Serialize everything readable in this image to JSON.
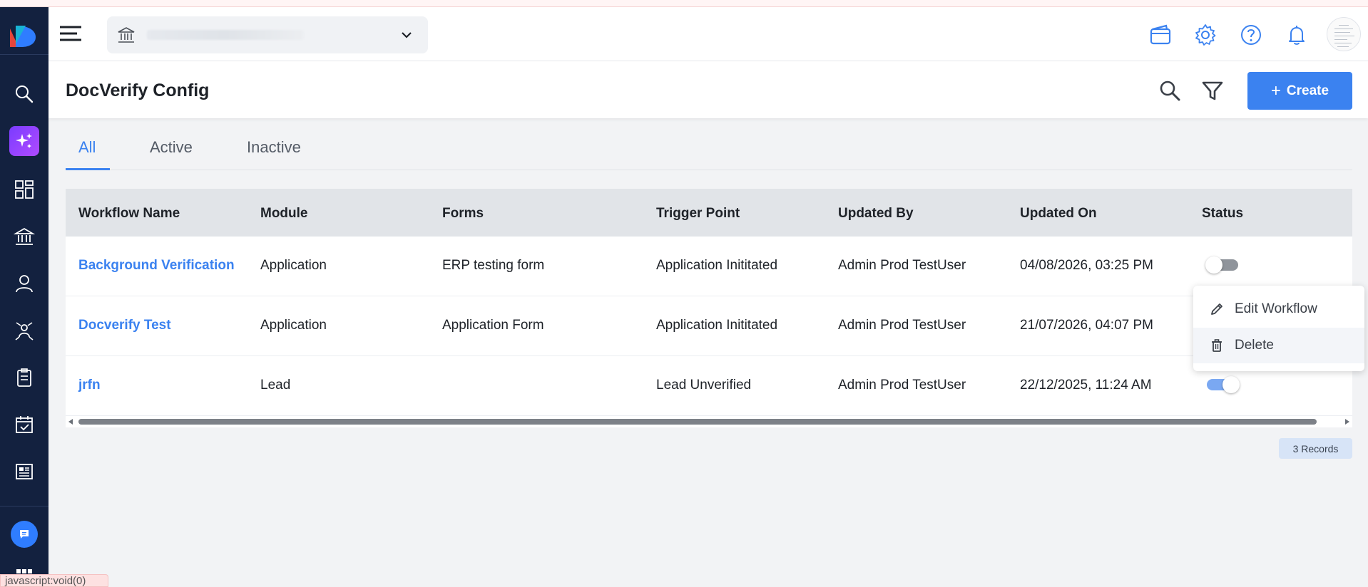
{
  "page": {
    "title": "DocVerify Config",
    "create_label": "Create"
  },
  "tabs": [
    {
      "label": "All",
      "active": true
    },
    {
      "label": "Active",
      "active": false
    },
    {
      "label": "Inactive",
      "active": false
    }
  ],
  "table": {
    "columns": [
      "Workflow Name",
      "Module",
      "Forms",
      "Trigger Point",
      "Updated By",
      "Updated On",
      "Status"
    ],
    "rows": [
      {
        "name": "Background Verification",
        "module": "Application",
        "forms": "ERP testing form",
        "trigger": "Application Inititated",
        "updated_by": "Admin Prod TestUser",
        "updated_on": "04/08/2026, 03:25 PM",
        "status_on": false
      },
      {
        "name": "Docverify Test",
        "module": "Application",
        "forms": "Application Form",
        "trigger": "Application Inititated",
        "updated_by": "Admin Prod TestUser",
        "updated_on": "21/07/2026, 04:07 PM",
        "status_on": null
      },
      {
        "name": "jrfn",
        "module": "Lead",
        "forms": "",
        "trigger": "Lead Unverified",
        "updated_by": "Admin Prod TestUser",
        "updated_on": "22/12/2025, 11:24 AM",
        "status_on": true
      }
    ],
    "records_label": "3 Records"
  },
  "context_menu": {
    "items": [
      {
        "label": "Edit Workflow",
        "icon": "pencil-icon"
      },
      {
        "label": "Delete",
        "icon": "trash-icon"
      }
    ]
  },
  "statusbar": {
    "text": "javascript:void(0)"
  },
  "colors": {
    "accent": "#3b82f0",
    "sidebar": "#13213f",
    "ai_gradient": "#8a3cff"
  }
}
